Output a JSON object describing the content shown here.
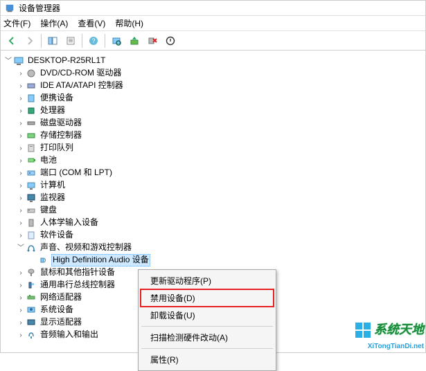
{
  "title": "设备管理器",
  "menu": {
    "file": "文件(F)",
    "action": "操作(A)",
    "view": "查看(V)",
    "help": "帮助(H)"
  },
  "tree": {
    "root": "DESKTOP-R25RL1T",
    "items": [
      {
        "label": "DVD/CD-ROM 驱动器"
      },
      {
        "label": "IDE ATA/ATAPI 控制器"
      },
      {
        "label": "便携设备"
      },
      {
        "label": "处理器"
      },
      {
        "label": "磁盘驱动器"
      },
      {
        "label": "存储控制器"
      },
      {
        "label": "打印队列"
      },
      {
        "label": "电池"
      },
      {
        "label": "端口 (COM 和 LPT)"
      },
      {
        "label": "计算机"
      },
      {
        "label": "监视器"
      },
      {
        "label": "键盘"
      },
      {
        "label": "人体学输入设备"
      },
      {
        "label": "软件设备"
      },
      {
        "label": "声音、视频和游戏控制器",
        "expanded": true,
        "children": [
          {
            "label": "High Definition Audio 设备",
            "selected": true
          }
        ]
      },
      {
        "label": "鼠标和其他指针设备"
      },
      {
        "label": "通用串行总线控制器"
      },
      {
        "label": "网络适配器"
      },
      {
        "label": "系统设备"
      },
      {
        "label": "显示适配器"
      },
      {
        "label": "音频输入和输出"
      }
    ]
  },
  "context_menu": {
    "update_driver": "更新驱动程序(P)",
    "disable_device": "禁用设备(D)",
    "uninstall_device": "卸载设备(U)",
    "scan_hardware": "扫描检测硬件改动(A)",
    "properties": "属性(R)"
  },
  "watermark": {
    "zh": "系统天地",
    "en": "XiTongTianDi.net"
  }
}
